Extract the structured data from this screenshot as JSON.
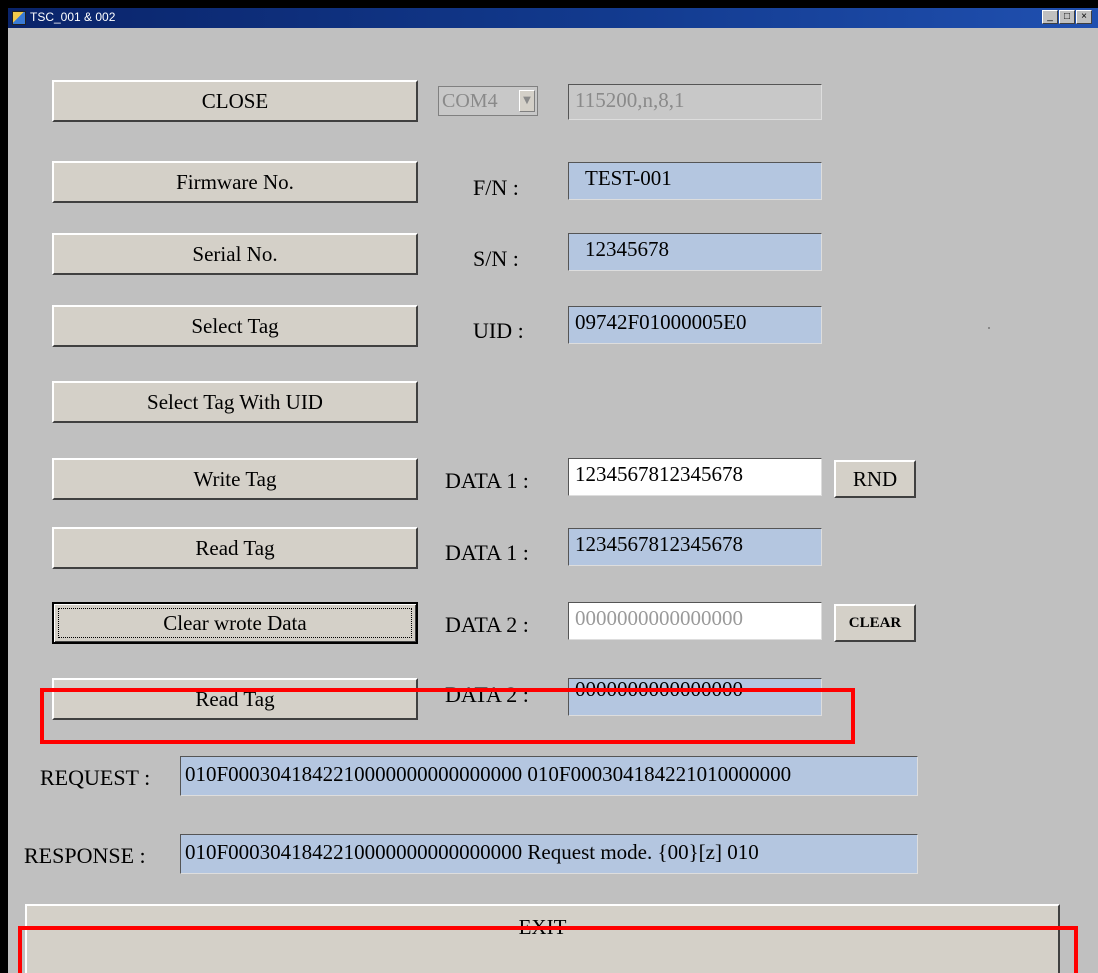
{
  "window": {
    "title": "TSC_001 & 002",
    "controls": {
      "minimize": "_",
      "maximize": "□",
      "close": "×"
    }
  },
  "connection": {
    "close_button": "CLOSE",
    "port": "COM4",
    "port_arrow": "▼",
    "settings": "115200,n,8,1"
  },
  "rows": {
    "firmware": {
      "button": "Firmware No.",
      "label": "F/N :",
      "value": "TEST-001"
    },
    "serial": {
      "button": "Serial No.",
      "label": "S/N :",
      "value": "12345678"
    },
    "select_tag": {
      "button": "Select Tag",
      "label": "UID :",
      "value": "09742F01000005E0"
    },
    "select_uid": {
      "button": "Select Tag With UID"
    },
    "write_tag": {
      "button": "Write Tag",
      "label": "DATA 1 :",
      "value": "1234567812345678",
      "rnd_button": "RND"
    },
    "read_tag1": {
      "button": "Read Tag",
      "label": "DATA 1 :",
      "value": "1234567812345678"
    },
    "clear_data": {
      "button": "Clear wrote Data",
      "label": "DATA 2 :",
      "value": "0000000000000000",
      "clear_button": "CLEAR"
    },
    "read_tag2": {
      "button": "Read Tag",
      "label": "DATA 2 :",
      "value": "0000000000000000"
    }
  },
  "request": {
    "label": "REQUEST :",
    "value": "010F0003041842210000000000000000   010F000304184221010000000"
  },
  "response": {
    "label": "RESPONSE :",
    "value": "010F0003041842210000000000000000  Request mode.  {00}[z]    010"
  },
  "exit_button": "EXIT",
  "colors": {
    "window_bg": "#c0c0c0",
    "field_blue": "#b4c6e0",
    "highlight_red": "#ff0000",
    "titlebar": "#0a246a"
  }
}
